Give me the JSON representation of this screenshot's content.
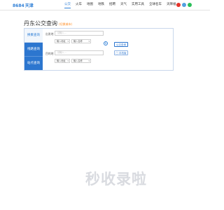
{
  "header": {
    "logo_main": "8684",
    "logo_city": "天津",
    "nav": [
      "公交",
      "火车",
      "地图",
      "地铁",
      "招聘",
      "天气",
      "实用工具",
      "全球名车",
      "天降福"
    ],
    "social_colors": [
      "#e5332a",
      "#52a0e0",
      "#2bbf59"
    ]
  },
  "page": {
    "title": "丹东公交查询",
    "title_extra": "(切换城市)"
  },
  "tabs": [
    "换乘查询",
    "线路查询",
    "站点查询"
  ],
  "form": {
    "from_label": "出发地",
    "to_label": "目的地",
    "from_placeholder": "请输入...",
    "to_placeholder": "请输入...",
    "dd_region": "输入地址",
    "dd_city": "输入名称",
    "swap_icon": "⇅",
    "search_button": "公交查询",
    "map_button": "□ 手机版"
  },
  "watermark": "秒收录啦"
}
